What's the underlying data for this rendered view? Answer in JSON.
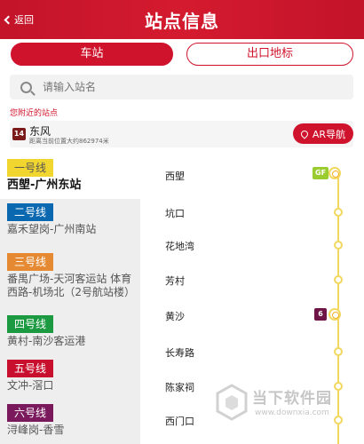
{
  "header": {
    "back_label": "返回",
    "title": "站点信息"
  },
  "tabs": {
    "active": "车站",
    "inactive": "出口地标"
  },
  "search": {
    "placeholder": "请输入站名"
  },
  "nearby": {
    "label": "您附近的站点",
    "line_badge": "14",
    "station_name": "东风",
    "distance_text": "距离当前位置大约862974米",
    "ar_button": "AR导航"
  },
  "lines": [
    {
      "tag": "一号线",
      "color": "#f2d630",
      "text_color": "#555555",
      "desc": "西塱-广州东站",
      "selected": true
    },
    {
      "tag": "二号线",
      "color": "#0a68b0",
      "text_color": "#ffffff",
      "desc": "嘉禾望岗-广州南站"
    },
    {
      "tag": "三号线",
      "color": "#e58a33",
      "text_color": "#ffffff",
      "desc": "番禺广场-天河客运站 体育西路-机场北（2号航站楼）"
    },
    {
      "tag": "四号线",
      "color": "#1c9a41",
      "text_color": "#ffffff",
      "desc": "黄村-南沙客运港"
    },
    {
      "tag": "五号线",
      "color": "#c8102e",
      "text_color": "#ffffff",
      "desc": "文冲-滘口"
    },
    {
      "tag": "六号线",
      "color": "#7a1a5c",
      "text_color": "#ffffff",
      "desc": "浔峰岗-香雪"
    }
  ],
  "stations": [
    {
      "name": "西塱",
      "transfer": true,
      "chip": "GF",
      "chip_color": "#9acb2f"
    },
    {
      "name": "坑口",
      "transfer": false
    },
    {
      "name": "花地湾",
      "transfer": false
    },
    {
      "name": "芳村",
      "transfer": false
    },
    {
      "name": "黄沙",
      "transfer": true,
      "chip": "6",
      "chip_color": "#6e1446"
    },
    {
      "name": "长寿路",
      "transfer": false
    },
    {
      "name": "陈家祠",
      "transfer": false
    },
    {
      "name": "西门口",
      "transfer": false
    }
  ],
  "watermark": {
    "text": "当下软件园",
    "url": "www.downxia.com"
  },
  "colors": {
    "brand_red": "#d0132c",
    "line1_yellow": "#f2d85e"
  }
}
